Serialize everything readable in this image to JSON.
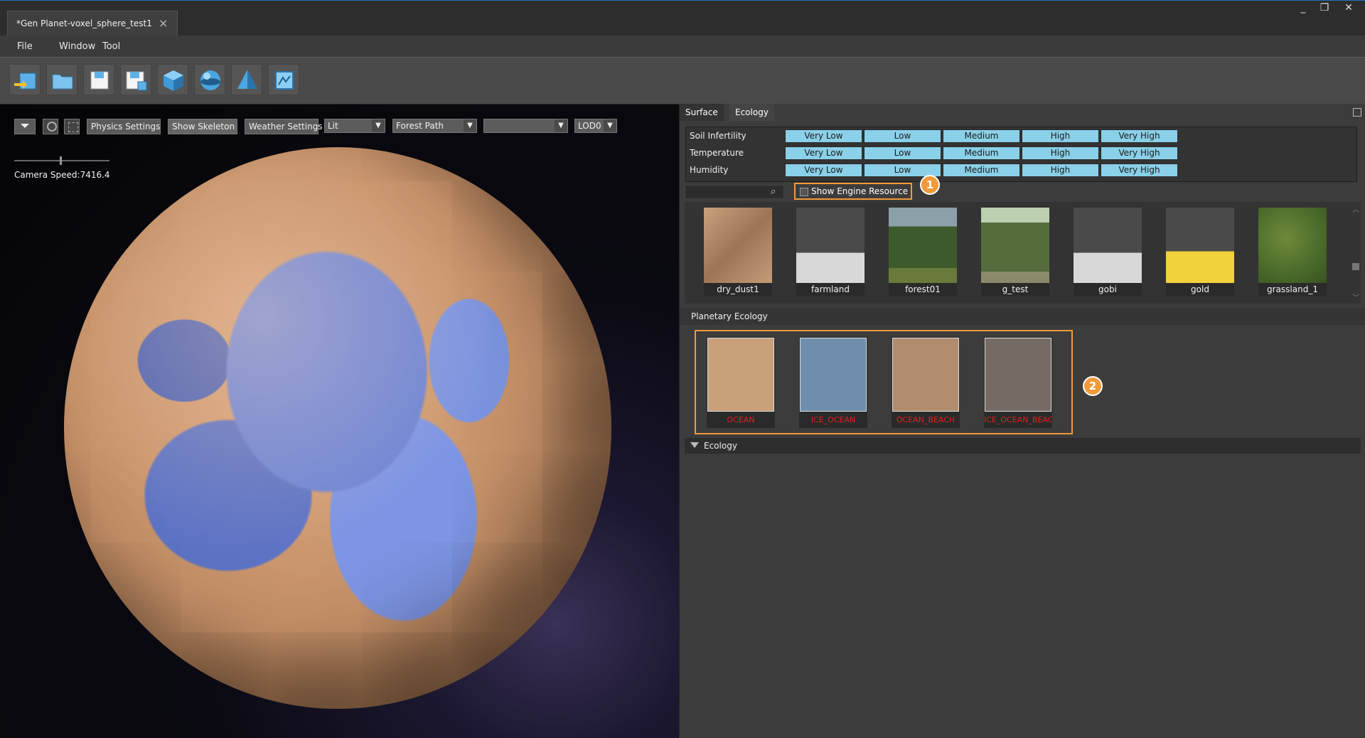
{
  "window": {
    "tab_title": "*Gen Planet-voxel_sphere_test1",
    "close_glyph": "×",
    "controls": [
      "_",
      "❐",
      "✕"
    ]
  },
  "menu": [
    "File",
    "Window",
    "Tool"
  ],
  "toolbar_icons": [
    "import-icon",
    "open-folder-icon",
    "save-icon",
    "save-as-icon",
    "cube-icon",
    "sphere-icon",
    "cone-icon",
    "frame-icon"
  ],
  "viewport": {
    "buttons": [
      "Physics Settings",
      "Show Skeleton",
      "Weather Settings"
    ],
    "dropdowns": [
      "Lit",
      "Forest Path",
      "",
      "LOD0"
    ],
    "camera_speed": "Camera Speed:7416.4"
  },
  "panel": {
    "tabs": [
      "Surface",
      "Ecology"
    ],
    "params": [
      "Soil Infertility",
      "Temperature",
      "Humidity"
    ],
    "levels": [
      "Very Low",
      "Low",
      "Medium",
      "High",
      "Very High"
    ],
    "engine_checkbox": "Show Engine Resource",
    "badge1": "1",
    "badge2": "2",
    "resources": [
      "dry_dust1",
      "farmland",
      "forest01",
      "g_test",
      "gobi",
      "gold",
      "grassland_1"
    ],
    "planetary_header": "Planetary Ecology",
    "ecology_items": [
      "OCEAN",
      "ICE_OCEAN",
      "OCEAN_BEACH",
      "ICE_OCEAN_BEAC"
    ],
    "ecology_colors": [
      "#c9a07a",
      "#6f8eab",
      "#b18c6e",
      "#766b64"
    ],
    "ecology_section": "Ecology"
  }
}
